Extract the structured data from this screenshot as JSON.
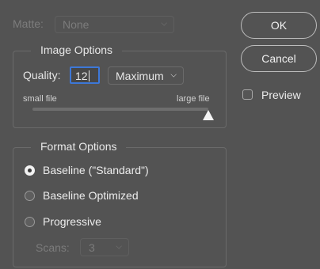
{
  "matte": {
    "label": "Matte:",
    "value": "None"
  },
  "image_options": {
    "title": "Image Options",
    "quality_label": "Quality:",
    "quality_value": "12",
    "quality_preset": "Maximum",
    "small_label": "small file",
    "large_label": "large file",
    "slider_level": 12
  },
  "format_options": {
    "title": "Format Options",
    "options": [
      "Baseline (\"Standard\")",
      "Baseline Optimized",
      "Progressive"
    ],
    "selected_index": 0,
    "scans_label": "Scans:",
    "scans_value": "3"
  },
  "buttons": {
    "ok": "OK",
    "cancel": "Cancel"
  },
  "preview": {
    "label": "Preview",
    "checked": false
  }
}
